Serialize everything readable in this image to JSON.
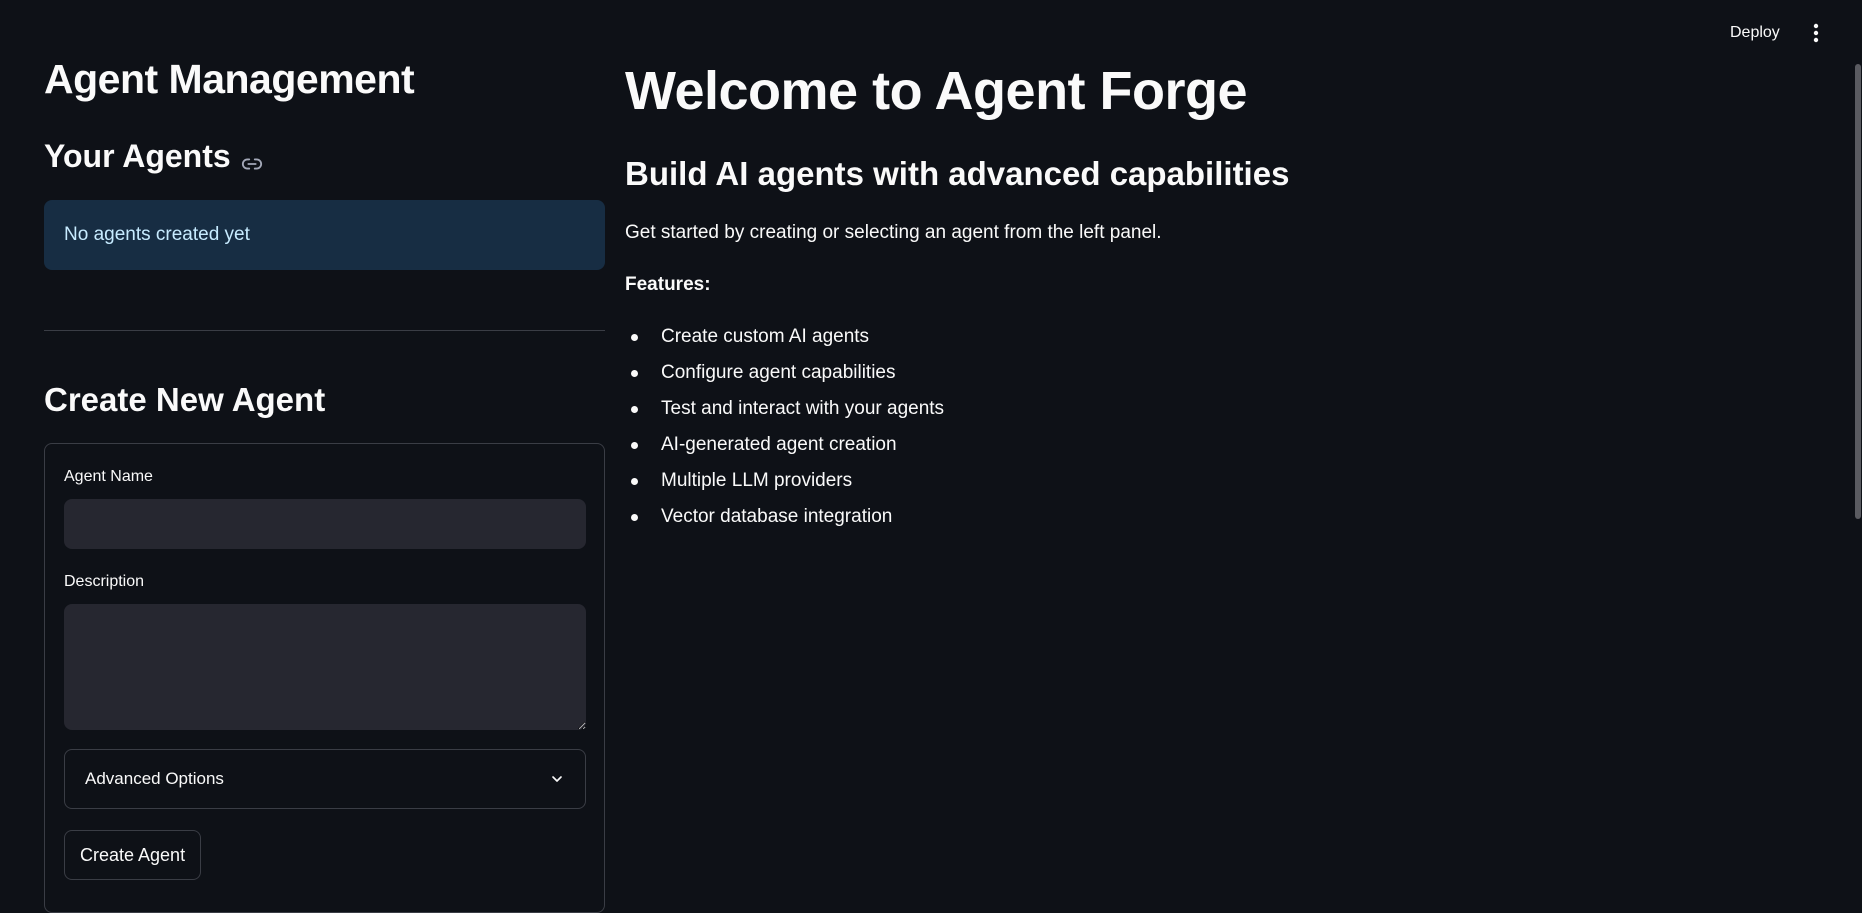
{
  "header": {
    "deploy_label": "Deploy",
    "menu_icon": "kebab-menu-icon"
  },
  "sidebar": {
    "title": "Agent Management",
    "your_agents_heading": "Your Agents",
    "link_icon": "link-icon",
    "empty_message": "No agents created yet",
    "create_heading": "Create New Agent",
    "form": {
      "agent_name_label": "Agent Name",
      "agent_name_value": "",
      "description_label": "Description",
      "description_value": "",
      "advanced_options_label": "Advanced Options",
      "submit_label": "Create Agent"
    }
  },
  "main": {
    "title": "Welcome to Agent Forge",
    "subtitle": "Build AI agents with advanced capabilities",
    "intro": "Get started by creating or selecting an agent from the left panel.",
    "features_label": "Features:",
    "features": [
      "Create custom AI agents",
      "Configure agent capabilities",
      "Test and interact with your agents",
      "AI-generated agent creation",
      "Multiple LLM providers",
      "Vector database integration"
    ]
  },
  "colors": {
    "background": "#0e1117",
    "info_box": "#172d43",
    "info_text": "#c7ebff",
    "input_bg": "#262730",
    "border": "#3a3d45"
  }
}
